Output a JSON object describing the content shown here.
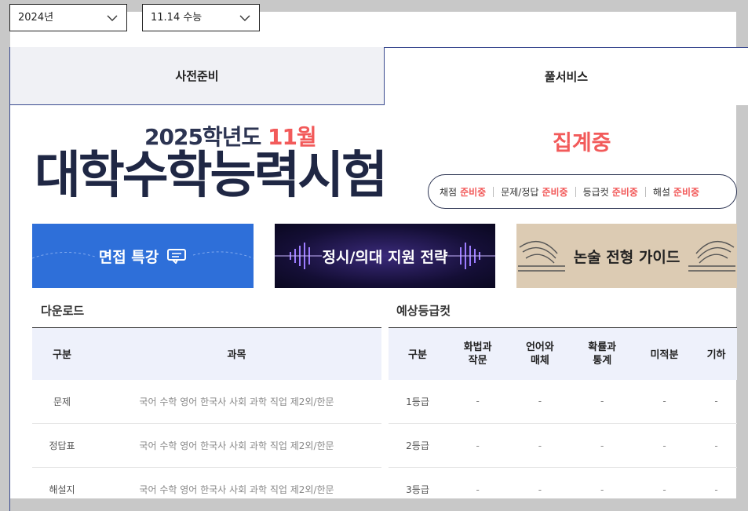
{
  "filters": {
    "year": "2024년",
    "exam": "11.14 수능"
  },
  "tabs": [
    {
      "label": "사전준비"
    },
    {
      "label": "풀서비스"
    }
  ],
  "hero": {
    "year_text": "2025학년도",
    "month_text": "11월",
    "title": "대학수학능력시험",
    "status": "집계중"
  },
  "status_items": [
    {
      "label": "채점",
      "value": "준비중"
    },
    {
      "label": "문제/정답",
      "value": "준비중"
    },
    {
      "label": "등급컷",
      "value": "준비중"
    },
    {
      "label": "해설",
      "value": "준비중"
    }
  ],
  "banners": [
    {
      "label": "면접 특강"
    },
    {
      "label": "정시/의대 지원 전략"
    },
    {
      "label": "논술 전형 가이드"
    }
  ],
  "download": {
    "title": "다운로드",
    "headers": [
      "구분",
      "과목"
    ],
    "rows": [
      {
        "type": "문제",
        "subjects": "국어 수학 영어 한국사 사회 과학 직업 제2외/한문"
      },
      {
        "type": "정답표",
        "subjects": "국어 수학 영어 한국사 사회 과학 직업 제2외/한문"
      },
      {
        "type": "해설지",
        "subjects": "국어 수학 영어 한국사 사회 과학 직업 제2외/한문"
      }
    ]
  },
  "grade_cut": {
    "title": "예상등급컷",
    "headers": [
      "구분",
      "화법과\n작문",
      "언어와\n매체",
      "확률과\n통계",
      "미적분",
      "기하"
    ],
    "rows": [
      {
        "grade": "1등급",
        "values": [
          "-",
          "-",
          "-",
          "-",
          "-"
        ]
      },
      {
        "grade": "2등급",
        "values": [
          "-",
          "-",
          "-",
          "-",
          "-"
        ]
      },
      {
        "grade": "3등급",
        "values": [
          "-",
          "-",
          "-",
          "-",
          "-"
        ]
      }
    ]
  },
  "colors": {
    "accent": "#f25a5a",
    "navy": "#1f2744",
    "tab_border": "#3a4a8f"
  },
  "icons": {
    "chevron": "chevron-down-icon",
    "chat": "chat-icon"
  }
}
